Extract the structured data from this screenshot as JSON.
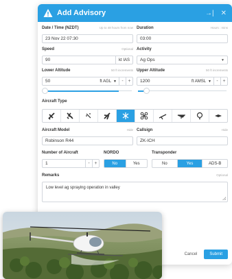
{
  "header": {
    "title": "Add Advisory",
    "icons": [
      "warning-icon",
      "collapse-icon",
      "close-icon"
    ]
  },
  "datetime": {
    "label": "Date / Time (NZDT)",
    "hint": "Up to 48 hours from now",
    "value": "23 Nov 22 07:30"
  },
  "duration": {
    "label": "Duration",
    "hint": "Hours : mins",
    "value": "03:00"
  },
  "speed": {
    "label": "Speed",
    "hint": "Optional",
    "value": "90",
    "unit": "kt IAS"
  },
  "activity": {
    "label": "Activity",
    "value": "Ag Ops"
  },
  "lower_altitude": {
    "label": "Lower Altitude",
    "hint": "50 ft increments",
    "value": "50",
    "unit": "ft AGL",
    "minus": "-",
    "plus": "+",
    "level": 0.05
  },
  "upper_altitude": {
    "label": "Upper Altitude",
    "hint": "50 ft increments",
    "value": "1200",
    "unit": "ft AMSL",
    "minus": "-",
    "plus": "+",
    "level": 0.12
  },
  "aircraft_type": {
    "label": "Aircraft Type",
    "types": [
      "jet-icon",
      "small-plane-icon",
      "drone-icon",
      "airliner-icon",
      "helicopter-icon",
      "quadcopter-icon",
      "glider-icon",
      "microlight-icon",
      "balloon-icon",
      "uav-icon"
    ],
    "selected_index": 4
  },
  "aircraft_model": {
    "label": "Aircraft Model",
    "hint": "Hide",
    "value": "Robinson R44"
  },
  "callsign": {
    "label": "Callsign",
    "hint": "Hide",
    "value": "ZK-ICH"
  },
  "aircraft_count": {
    "label": "Number of Aircraft",
    "value": "1",
    "minus": "-",
    "plus": "+"
  },
  "nordo": {
    "label": "NORDO",
    "options": [
      "No",
      "Yes"
    ],
    "selected": "No"
  },
  "transponder": {
    "label": "Transponder",
    "options": [
      "No",
      "Yes",
      "ADS-B"
    ],
    "selected": "Yes"
  },
  "remarks": {
    "label": "Remarks",
    "hint": "Optional",
    "value": "Low level ag spraying operation in valley"
  },
  "footer": {
    "cancel": "Cancel",
    "submit": "Submit"
  },
  "colors": {
    "accent": "#2aa0e3"
  }
}
